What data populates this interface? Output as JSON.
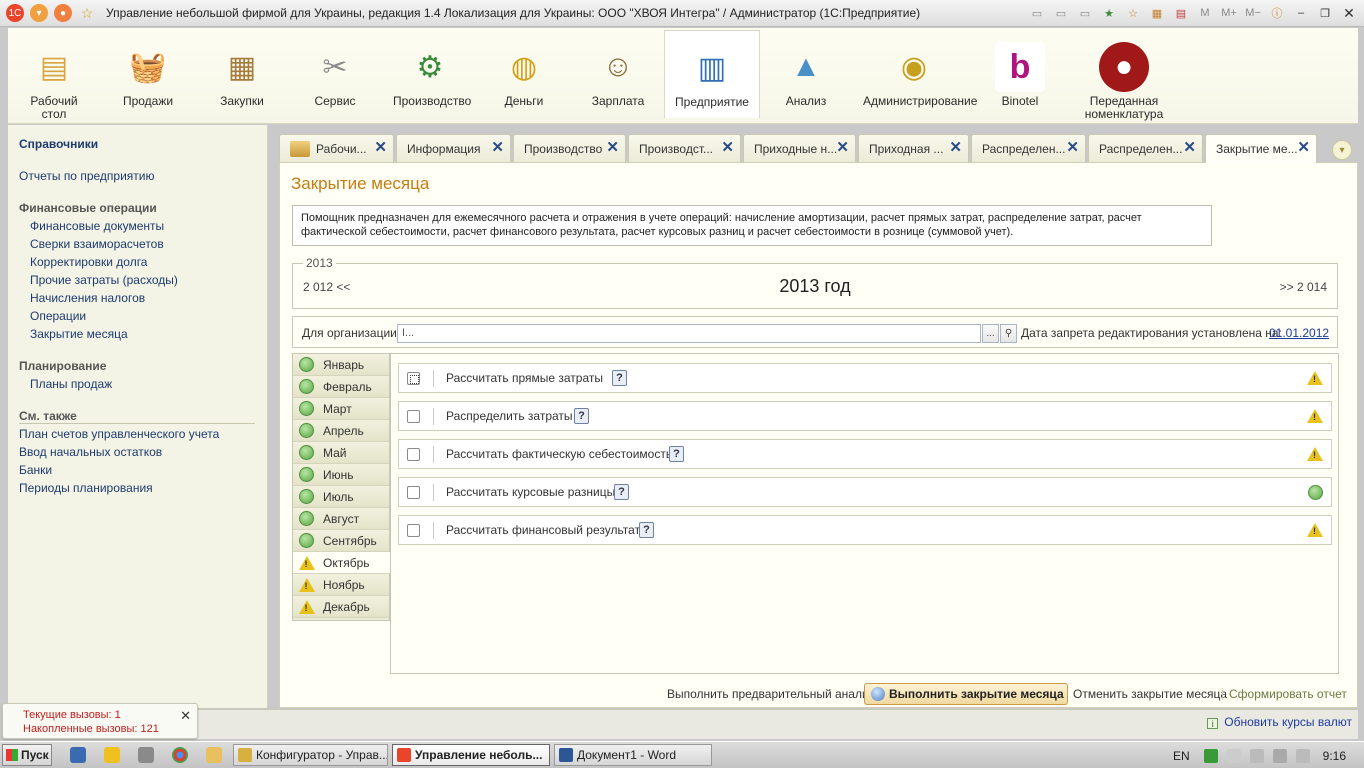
{
  "window": {
    "title": "Управление небольшой фирмой для Украины, редакция 1.4 Локализация для Украины: ООО \"ХВОЯ Интегра\" / Администратор  (1С:Предприятие)"
  },
  "sections": [
    {
      "label": "Рабочий стол",
      "icon": "desk-icon",
      "color": "#d9a441"
    },
    {
      "label": "Продажи",
      "icon": "shopping-basket-icon",
      "color": "#c0392b"
    },
    {
      "label": "Закупки",
      "icon": "boxes-cart-icon",
      "color": "#a67c3d"
    },
    {
      "label": "Сервис",
      "icon": "tools-icon",
      "color": "#8a8a8a"
    },
    {
      "label": "Производство",
      "icon": "factory-icon",
      "color": "#3a8a3a"
    },
    {
      "label": "Деньги",
      "icon": "coins-icon",
      "color": "#d4a017"
    },
    {
      "label": "Зарплата",
      "icon": "person-coins-icon",
      "color": "#8a6a3a"
    },
    {
      "label": "Предприятие",
      "icon": "building-icon",
      "color": "#2e6fb3"
    },
    {
      "label": "Анализ",
      "icon": "chart-icon",
      "color": "#4a90c8"
    },
    {
      "label": "Администрирование",
      "icon": "database-icon",
      "color": "#c8a020"
    },
    {
      "label": "Binotel",
      "icon": "binotel-logo-icon",
      "color": "#b0157f"
    },
    {
      "label": "Переданная номенклатура",
      "icon": "coffee-bean-icon",
      "color": "#a01818"
    }
  ],
  "left_panel": {
    "heading": "Справочники",
    "reports": "Отчеты по предприятию",
    "fin_group": "Финансовые операции",
    "fin_items": [
      "Финансовые документы",
      "Сверки взаиморасчетов",
      "Корректировки долга",
      "Прочие затраты (расходы)",
      "Начисления налогов",
      "Операции",
      "Закрытие месяца"
    ],
    "plan_group": "Планирование",
    "plan_items": [
      "Планы продаж"
    ],
    "see_also": "См. также",
    "see_items": [
      "План счетов управленческого учета",
      "Ввод начальных остатков",
      "Банки",
      "Периоды планирования"
    ]
  },
  "tabs": [
    "Рабочи...",
    "Информация",
    "Производство",
    "Производст...",
    "Приходные н...",
    "Приходная ...",
    "Распределен...",
    "Распределен...",
    "Закрытие ме..."
  ],
  "form": {
    "title": "Закрытие месяца",
    "info": "Помощник предназначен для ежемесячного расчета и отражения в учете операций: начисление амортизации, расчет прямых затрат, распределение затрат, расчет фактической себестоимости, расчет финансового результата, расчет курсовых разниц и расчет себестоимости в рознице (суммовой учет).",
    "year_legend": "2013",
    "year_prev": "2 012 <<",
    "year_current": "2013 год",
    "year_next": ">> 2 014",
    "org_label": "Для организации:",
    "org_value": "I...",
    "org_select_btn": "...",
    "lock_label": "Дата запрета редактирования установлена на:",
    "lock_date": "01.01.2012"
  },
  "months": [
    {
      "name": "Январь",
      "status": "ok"
    },
    {
      "name": "Февраль",
      "status": "ok"
    },
    {
      "name": "Март",
      "status": "ok"
    },
    {
      "name": "Апрель",
      "status": "ok"
    },
    {
      "name": "Май",
      "status": "ok"
    },
    {
      "name": "Июнь",
      "status": "ok"
    },
    {
      "name": "Июль",
      "status": "ok"
    },
    {
      "name": "Август",
      "status": "ok"
    },
    {
      "name": "Сентябрь",
      "status": "ok"
    },
    {
      "name": "Октябрь",
      "status": "warning"
    },
    {
      "name": "Ноябрь",
      "status": "warning"
    },
    {
      "name": "Декабрь",
      "status": "warning"
    }
  ],
  "operations": [
    {
      "label": "Рассчитать прямые затраты",
      "checked": false,
      "status": "warning"
    },
    {
      "label": "Распределить затраты",
      "checked": false,
      "status": "warning"
    },
    {
      "label": "Рассчитать фактическую себестоимость",
      "checked": false,
      "status": "warning"
    },
    {
      "label": "Рассчитать курсовые разницы",
      "checked": false,
      "status": "ok"
    },
    {
      "label": "Рассчитать финансовый результат",
      "checked": false,
      "status": "warning"
    }
  ],
  "help_label": "?",
  "actions": {
    "preliminary": "Выполнить предварительный анализ",
    "execute": "Выполнить закрытие месяца",
    "cancel": "Отменить закрытие месяца",
    "report": "Сформировать отчет"
  },
  "calls": {
    "current": "Текущие вызовы: 1",
    "accumulated": "Накопленные вызовы: 121"
  },
  "rates_link": "Обновить курсы валют",
  "taskbar": {
    "start": "Пуск",
    "tasks": [
      "Конфигуратор - Управ...",
      "Управление неболь...",
      "Документ1 - Word"
    ],
    "lang": "EN",
    "time": "9:16"
  }
}
